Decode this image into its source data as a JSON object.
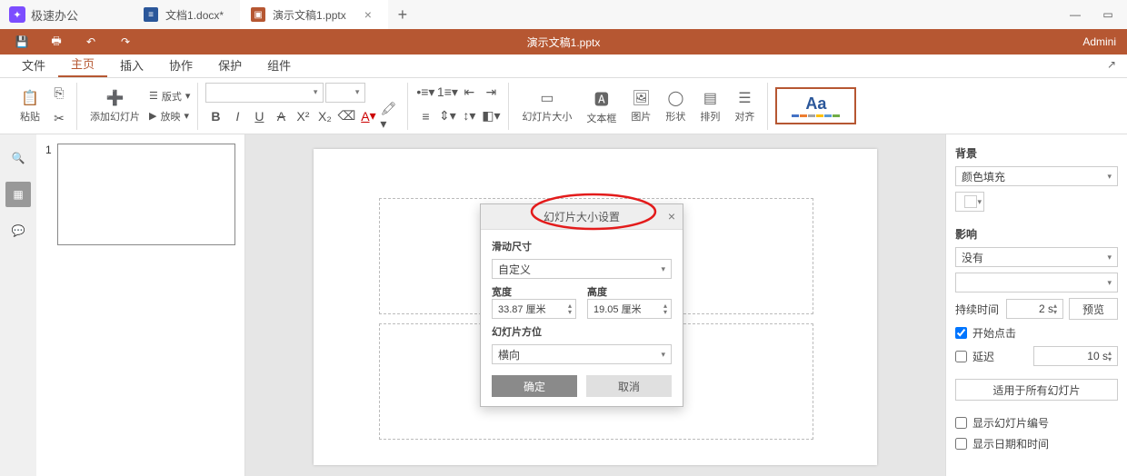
{
  "app": {
    "name": "极速办公"
  },
  "tabs": {
    "doc": {
      "label": "文档1.docx*",
      "icon_bg": "#2b579a"
    },
    "ppt": {
      "label": "演示文稿1.pptx",
      "icon_bg": "#b65732"
    }
  },
  "actionbar": {
    "title": "演示文稿1.pptx",
    "user": "Admini"
  },
  "menu": {
    "file": "文件",
    "home": "主页",
    "insert": "插入",
    "collab": "协作",
    "protect": "保护",
    "plugins": "组件"
  },
  "ribbon": {
    "paste": "粘贴",
    "add_slide": "添加幻灯片",
    "layout": "版式",
    "playback": "放映",
    "slide_size": "幻灯片大小",
    "textbox": "文本框",
    "image": "图片",
    "shape": "形状",
    "arrange": "排列",
    "align": "对齐"
  },
  "thumb": {
    "num": "1"
  },
  "dialog": {
    "title": "幻灯片大小设置",
    "slide_size_label": "滑动尺寸",
    "size_value": "自定义",
    "width_label": "宽度",
    "width_value": "33.87 厘米",
    "height_label": "高度",
    "height_value": "19.05 厘米",
    "orientation_label": "幻灯片方位",
    "orientation_value": "横向",
    "ok": "确定",
    "cancel": "取消"
  },
  "props": {
    "bg_label": "背景",
    "bg_fill": "颜色填充",
    "effect_label": "影响",
    "effect_value": "没有",
    "duration_label": "持续时间",
    "duration_value": "2 s",
    "preview": "预览",
    "start_on_click": "开始点击",
    "delay_label": "延迟",
    "delay_value": "10 s",
    "apply_all": "适用于所有幻灯片",
    "show_slide_no": "显示幻灯片编号",
    "show_datetime": "显示日期和时间"
  }
}
